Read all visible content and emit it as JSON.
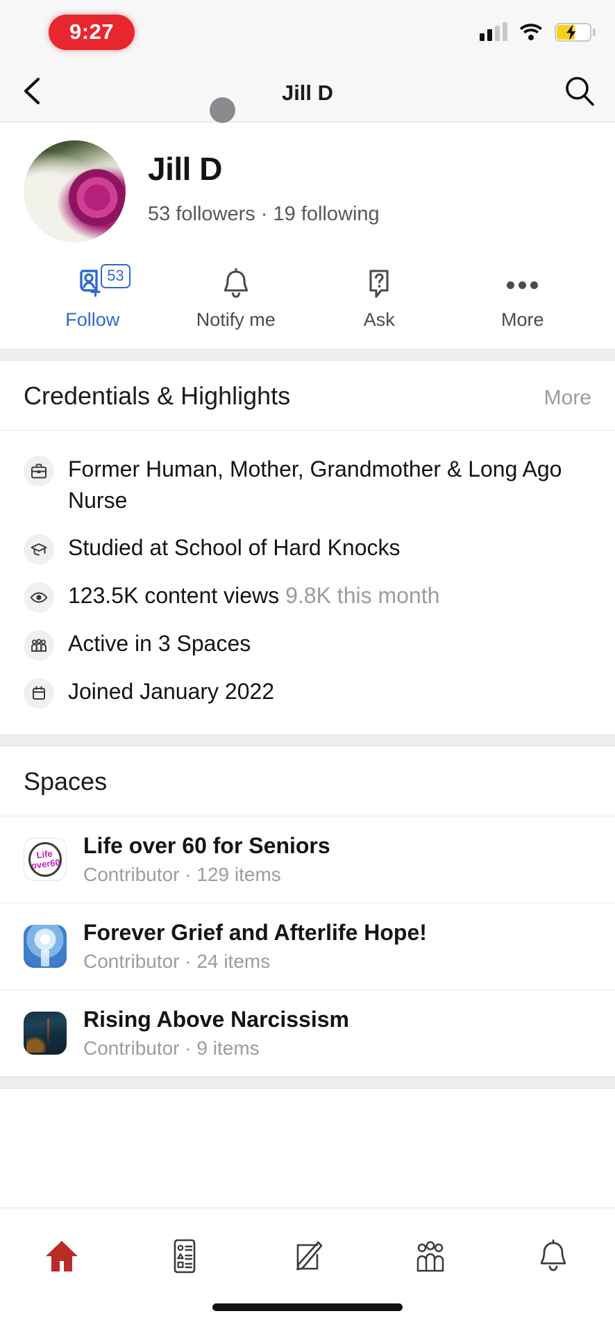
{
  "status_bar": {
    "time": "9:27",
    "icons": [
      "cellular-signal-icon",
      "wifi-icon",
      "battery-charging-icon"
    ],
    "battery_state": "charging",
    "accent_time_pill": "#e8262d",
    "battery_fill_color": "#f7d117"
  },
  "nav": {
    "back_icon": "chevron-left-icon",
    "title": "Jill D",
    "search_icon": "search-icon"
  },
  "profile": {
    "name": "Jill D",
    "stats": "53 followers · 19 following",
    "followers": "53",
    "following": "19",
    "avatar_icon": "profile-avatar-roses"
  },
  "actions": [
    {
      "label": "Follow",
      "icon": "person-add-icon",
      "badge": "53",
      "active": true,
      "accent": "#2e69d2"
    },
    {
      "label": "Notify me",
      "icon": "bell-icon",
      "badge": "",
      "active": false
    },
    {
      "label": "Ask",
      "icon": "question-bubble-icon",
      "badge": "",
      "active": false
    },
    {
      "label": "More",
      "icon": "ellipsis-icon",
      "badge": "",
      "active": false
    }
  ],
  "credentials": {
    "title": "Credentials & Highlights",
    "more_label": "More",
    "items": [
      {
        "icon": "briefcase-icon",
        "text": "Former Human, Mother, Grandmother & Long Ago Nurse",
        "muted": ""
      },
      {
        "icon": "graduation-cap-icon",
        "text": "Studied at School of Hard Knocks",
        "muted": ""
      },
      {
        "icon": "eye-icon",
        "text": "123.5K content views ",
        "muted": "9.8K this month"
      },
      {
        "icon": "people-group-icon",
        "text": "Active in 3 Spaces",
        "muted": ""
      },
      {
        "icon": "calendar-icon",
        "text": "Joined January 2022",
        "muted": ""
      }
    ]
  },
  "spaces": {
    "title": "Spaces",
    "items": [
      {
        "name": "Life over 60 for Seniors",
        "sub": "Contributor · 129 items",
        "role": "Contributor",
        "items_count": "129 items",
        "icon": "space-avatar-life-over-60"
      },
      {
        "name": "Forever Grief and Afterlife Hope!",
        "sub": "Contributor · 24 items",
        "role": "Contributor",
        "items_count": "24 items",
        "icon": "space-avatar-forever-grief"
      },
      {
        "name": "Rising Above Narcissism",
        "sub": "Contributor · 9 items",
        "role": "Contributor",
        "items_count": "9 items",
        "icon": "space-avatar-rising-above-narcissism"
      }
    ]
  },
  "bottom_nav": {
    "items": [
      {
        "name": "home",
        "icon": "home-icon",
        "active": true,
        "color": "#b92b27"
      },
      {
        "name": "following",
        "icon": "list-feed-icon",
        "active": false,
        "color": "#3a3a3a"
      },
      {
        "name": "answer",
        "icon": "compose-pencil-icon",
        "active": false,
        "color": "#3a3a3a"
      },
      {
        "name": "spaces",
        "icon": "people-spaces-icon",
        "active": false,
        "color": "#3a3a3a"
      },
      {
        "name": "notifications",
        "icon": "bell-icon",
        "active": false,
        "color": "#3a3a3a"
      }
    ]
  }
}
